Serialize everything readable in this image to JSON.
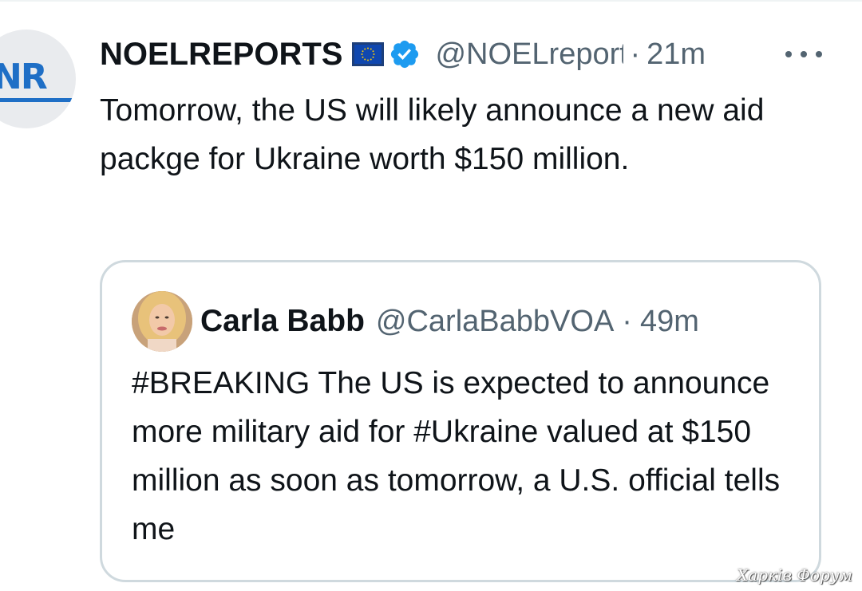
{
  "tweet": {
    "author": {
      "avatar_text": "NR",
      "display_name": "NOELREPORTS",
      "flag_icon": "eu-flag-icon",
      "verified_icon": "verified-badge-icon",
      "handle": "@NOELreports",
      "separator": "·",
      "time": "21m"
    },
    "more_icon": "more-options-icon",
    "text": "Tomorrow, the US will likely announce a new aid packge for Ukraine worth $150 million."
  },
  "quoted_tweet": {
    "author": {
      "display_name": "Carla Babb",
      "handle": "@CarlaBabbVOA",
      "separator": "·",
      "time": "49m"
    },
    "text": "#BREAKING The US is expected to announce more military aid for #Ukraine valued at $150 million as soon as tomorrow, a U.S. official tells me"
  },
  "watermark": "Харків Форум",
  "colors": {
    "text_primary": "#0f1419",
    "text_secondary": "#536471",
    "verified_blue": "#1d9bf0",
    "card_border": "#cfd9de",
    "eu_blue": "#0f47af",
    "eu_star": "#ffcc00"
  }
}
